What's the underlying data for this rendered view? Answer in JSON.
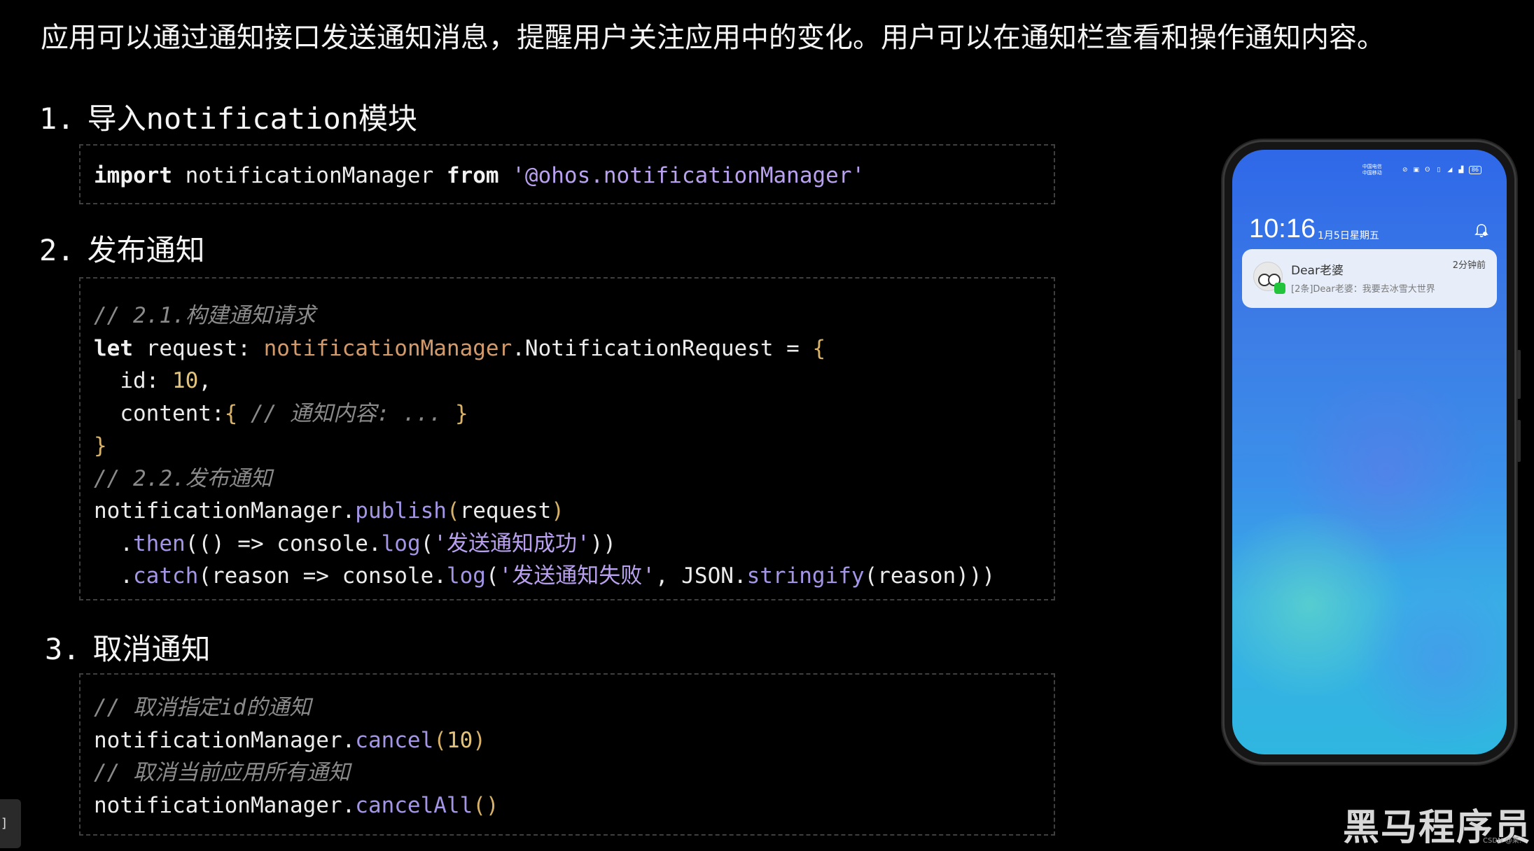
{
  "intro": "应用可以通过通知接口发送通知消息，提醒用户关注应用中的变化。用户可以在通知栏查看和操作通知内容。",
  "sections": [
    {
      "num": "1.",
      "title_prefix": "导入",
      "title_mono": "notification",
      "title_suffix": "模块"
    },
    {
      "num": "2.",
      "title": "发布通知"
    },
    {
      "num": "3.",
      "title": "取消通知"
    }
  ],
  "code1": {
    "kw_import": "import",
    "name": " notificationManager ",
    "kw_from": "from",
    "module": "'@ohos.notificationManager'"
  },
  "code2": {
    "comment1": "// 2.1.构建通知请求",
    "kw_let": "let",
    "var_decl": " request: ",
    "type_obj": "notificationManager",
    "type_name": ".NotificationRequest = ",
    "open_brace": "{",
    "id_key": "  id: ",
    "id_val": "10",
    "comma": ",",
    "content_key": "  content:",
    "content_open": "{ ",
    "content_comment": "// 通知内容: ... ",
    "content_close": "}",
    "close_brace": "}",
    "comment2": "// 2.2.发布通知",
    "publish_obj": "notificationManager.",
    "publish_fn": "publish",
    "publish_open": "(",
    "publish_arg": "request",
    "publish_close": ")",
    "then_dot": "  .",
    "then_fn": "then",
    "then_open": "(() => console.",
    "then_log": "log",
    "then_paren": "(",
    "then_str": "'发送通知成功'",
    "then_close": "))",
    "catch_dot": "  .",
    "catch_fn": "catch",
    "catch_open": "(reason => console.",
    "catch_log": "log",
    "catch_paren": "(",
    "catch_str": "'发送通知失败'",
    "catch_mid": ", JSON.",
    "catch_stringify": "stringify",
    "catch_tail": "(reason)))"
  },
  "code3": {
    "comment1": "// 取消指定id的通知",
    "cancel_obj": "notificationManager.",
    "cancel_fn": "cancel",
    "cancel_open": "(",
    "cancel_arg": "10",
    "cancel_close": ")",
    "comment2": "// 取消当前应用所有通知",
    "cancelall_obj": "notificationManager.",
    "cancelall_fn": "cancelAll",
    "cancelall_parens": "()"
  },
  "phone": {
    "carrier_line1": "中国电信",
    "carrier_line2": "中国移动",
    "battery": "86",
    "time": "10:16",
    "date": "1月5日星期五",
    "bell_icon": "bell-icon",
    "notification": {
      "title": "Dear老婆",
      "time": "2分钟前",
      "body": "[2条]Dear老婆：我要去冰雪大世界",
      "app_icon": "wechat-icon"
    }
  },
  "watermark": "黑马程序员",
  "csdn_mark": "CSDN @某.",
  "left_tab_char": "]",
  "colors": {
    "background": "#000000",
    "keyword": "#f1f1f1",
    "string": "#b9a1f0",
    "comment": "#8a8a8a",
    "object": "#d39a6c",
    "function": "#a495e6",
    "number": "#e4c37a"
  }
}
